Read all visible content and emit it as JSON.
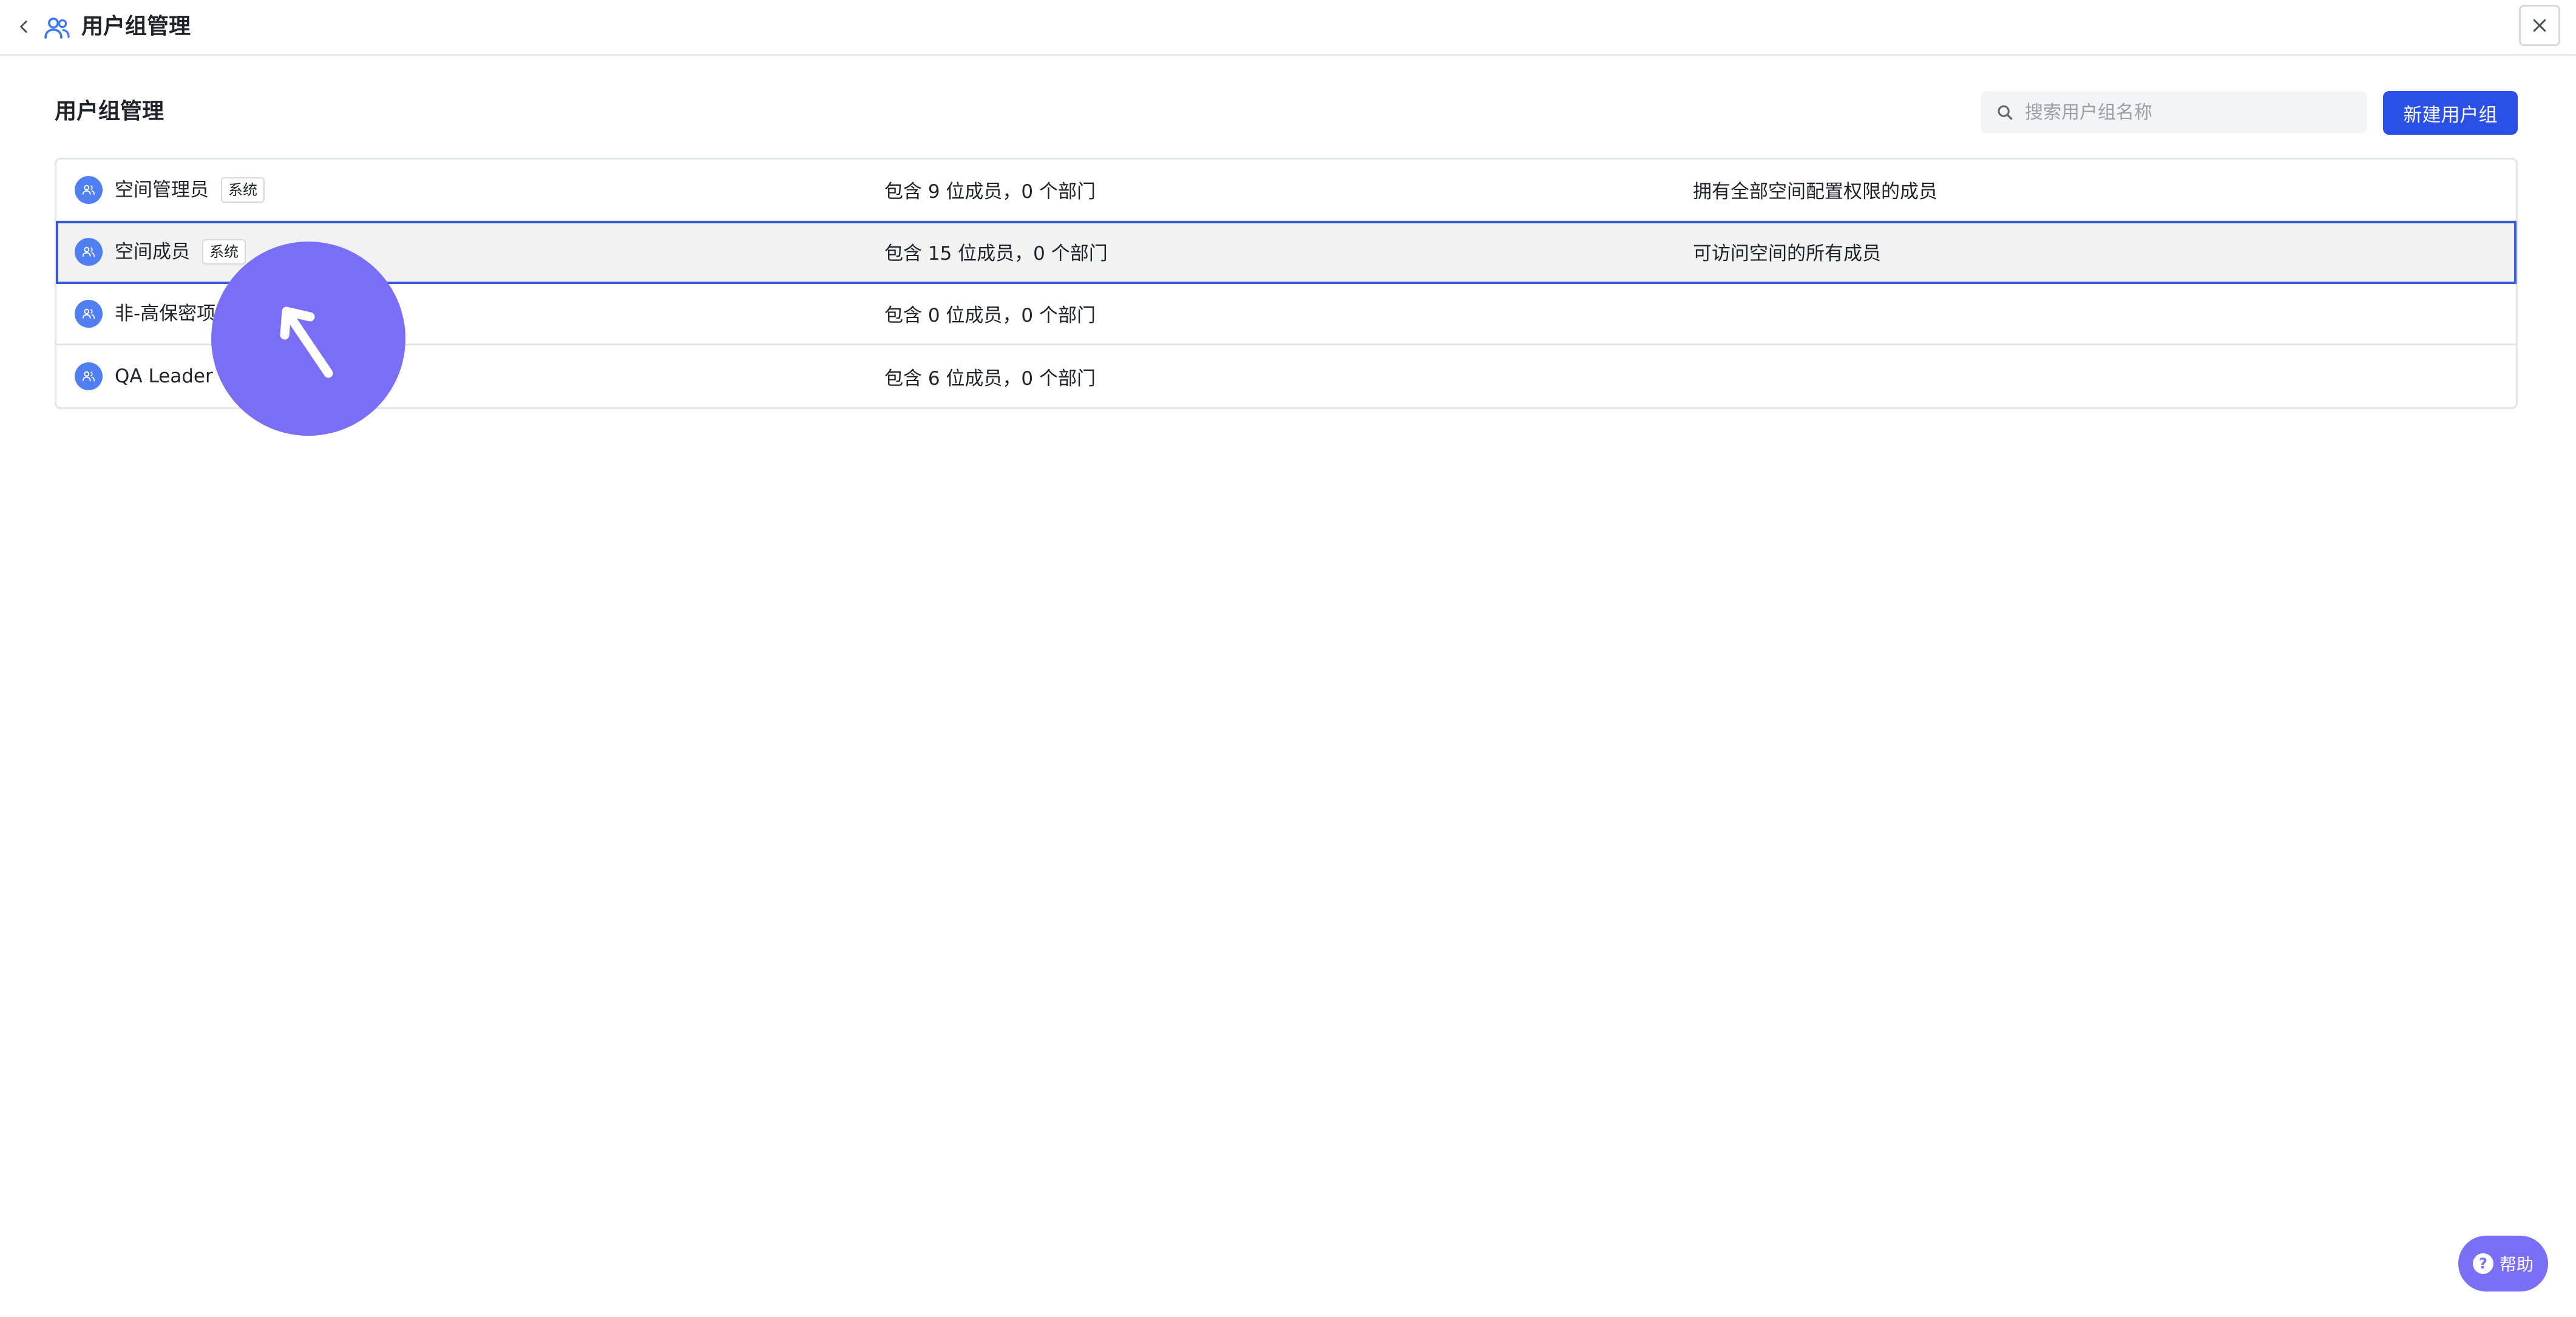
{
  "header": {
    "title": "用户组管理",
    "back_icon": "chevron-left-icon",
    "title_icon": "user-group-icon",
    "close_icon": "close-icon"
  },
  "section": {
    "title": "用户组管理"
  },
  "search": {
    "placeholder": "搜索用户组名称",
    "value": ""
  },
  "actions": {
    "new_group_label": "新建用户组"
  },
  "colors": {
    "accent": "#2a50e6",
    "group_icon": "#4f7ff0",
    "selection_border": "#3a5bd9",
    "cursor_overlay": "#7b6ef6"
  },
  "groups": [
    {
      "name": "空间管理员",
      "tag": "系统",
      "count": "包含 9 位成员，0 个部门",
      "description": "拥有全部空间配置权限的成员",
      "selected": false
    },
    {
      "name": "空间成员",
      "tag": "系统",
      "count": "包含 15 位成员，0 个部门",
      "description": "可访问空间的所有成员",
      "selected": true
    },
    {
      "name": "非-高保密项",
      "tag": "",
      "count": "包含 0 位成员，0 个部门",
      "description": "",
      "selected": false
    },
    {
      "name": "QA Leader",
      "tag": "",
      "count": "包含 6 位成员，0 个部门",
      "description": "",
      "selected": false
    }
  ],
  "help": {
    "label": "帮助",
    "icon_glyph": "?"
  }
}
